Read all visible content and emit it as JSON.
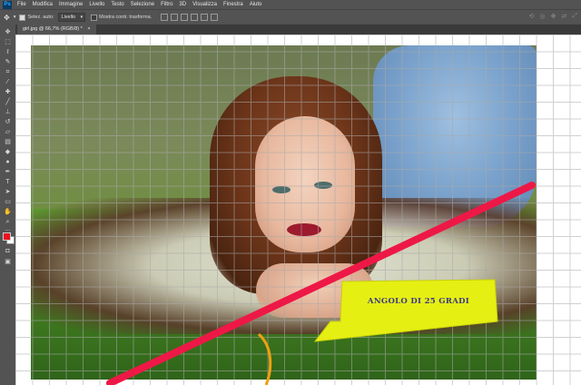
{
  "menubar": {
    "logo": "Ps",
    "items": [
      "File",
      "Modifica",
      "Immagine",
      "Livello",
      "Testo",
      "Selezione",
      "Filtro",
      "3D",
      "Visualizza",
      "Finestra",
      "Aiuto"
    ]
  },
  "options": {
    "auto_select_label": "Selez. auto:",
    "auto_select_checked": true,
    "auto_select_value": "Livello",
    "show_transform_label": "Mostra contr. trasforma.",
    "show_transform_checked": false
  },
  "document_tab": {
    "label": "girl.jpg @ 66,7% (RGB/8) *",
    "close": "×"
  },
  "colors": {
    "foreground": "#e8121f",
    "background": "#ffffff",
    "accent_line": "#ee1846",
    "callout_fill": "#e6ef12"
  },
  "toolbar_icons": [
    "move-icon",
    "marquee-icon",
    "lasso-icon",
    "quick-select-icon",
    "crop-icon",
    "eyedropper-icon",
    "healing-icon",
    "brush-icon",
    "clone-stamp-icon",
    "history-brush-icon",
    "eraser-icon",
    "gradient-icon",
    "blur-icon",
    "dodge-icon",
    "pen-icon",
    "type-icon",
    "path-select-icon",
    "shape-icon",
    "hand-icon",
    "zoom-icon",
    "more-icon"
  ],
  "callout": {
    "text": "ANGOLO DI 25 GRADI"
  }
}
